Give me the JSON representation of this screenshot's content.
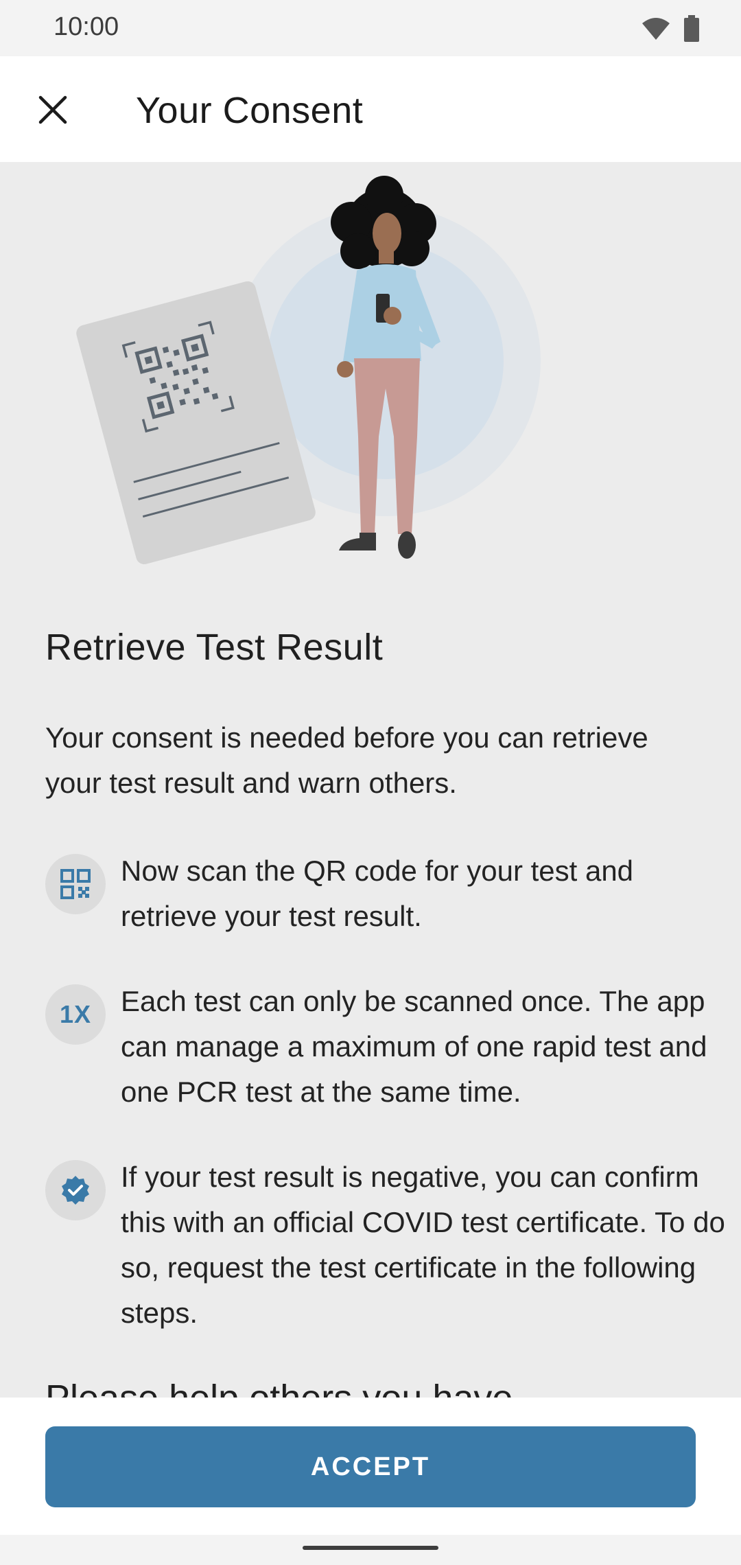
{
  "status_bar": {
    "time": "10:00",
    "icons": [
      "wifi-icon",
      "battery-icon"
    ]
  },
  "app_bar": {
    "title": "Your Consent",
    "close_icon": "close-icon"
  },
  "content": {
    "section_title": "Retrieve Test Result",
    "intro": "Your consent is needed before you can retrieve your test result and warn others.",
    "bullets": [
      {
        "icon": "qr-code-icon",
        "text": "Now scan the QR code for your test and retrieve your test result."
      },
      {
        "icon": "once-icon",
        "icon_label": "1X",
        "text": "Each test can only be scanned once. The app can manage a maximum of one rapid test and one PCR test at the same time."
      },
      {
        "icon": "verified-badge-icon",
        "text": "If your test result is negative, you can confirm this with an official COVID test certificate. To do so, request the test certificate in the following steps."
      }
    ],
    "next_heading_partial": "Please help others you have"
  },
  "footer": {
    "accept_label": "ACCEPT"
  },
  "colors": {
    "accent": "#3a7aa8",
    "background": "#ececec",
    "app_bar": "#ffffff"
  }
}
